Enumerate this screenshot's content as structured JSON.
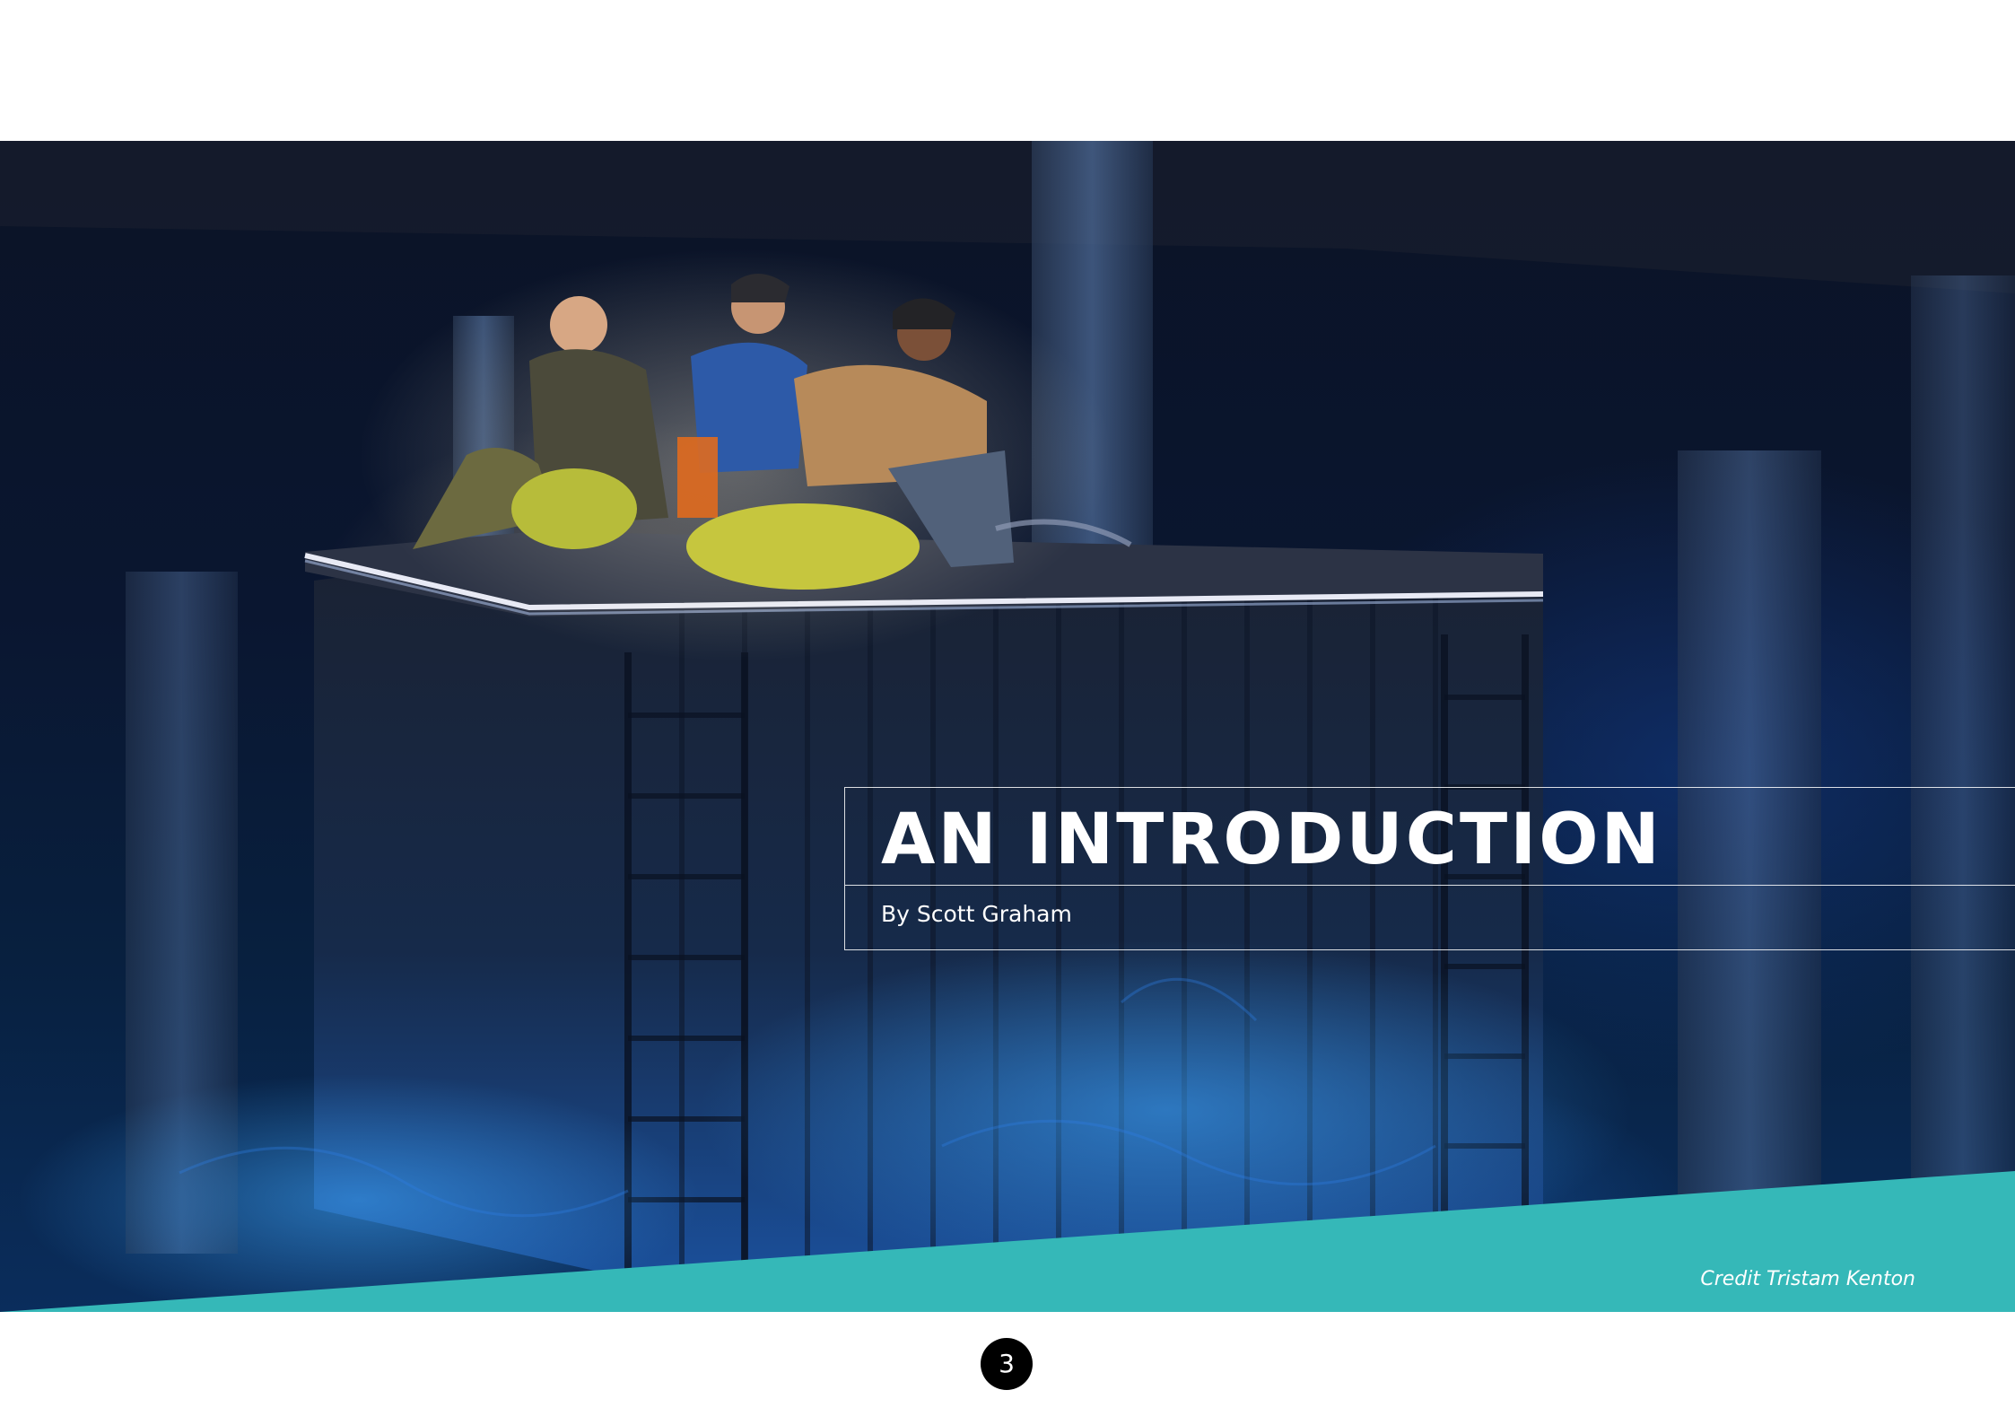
{
  "page": {
    "title": "AN INTRODUCTION",
    "byline": "By Scott Graham",
    "photo_credit": "Credit Tristam Kenton",
    "page_number": "3"
  },
  "colors": {
    "accent_teal": "#35b8b8",
    "background": "#ffffff",
    "page_badge": "#000000",
    "text_on_photo": "#ffffff"
  },
  "icons": {
    "photo": "stage-production-photo"
  }
}
